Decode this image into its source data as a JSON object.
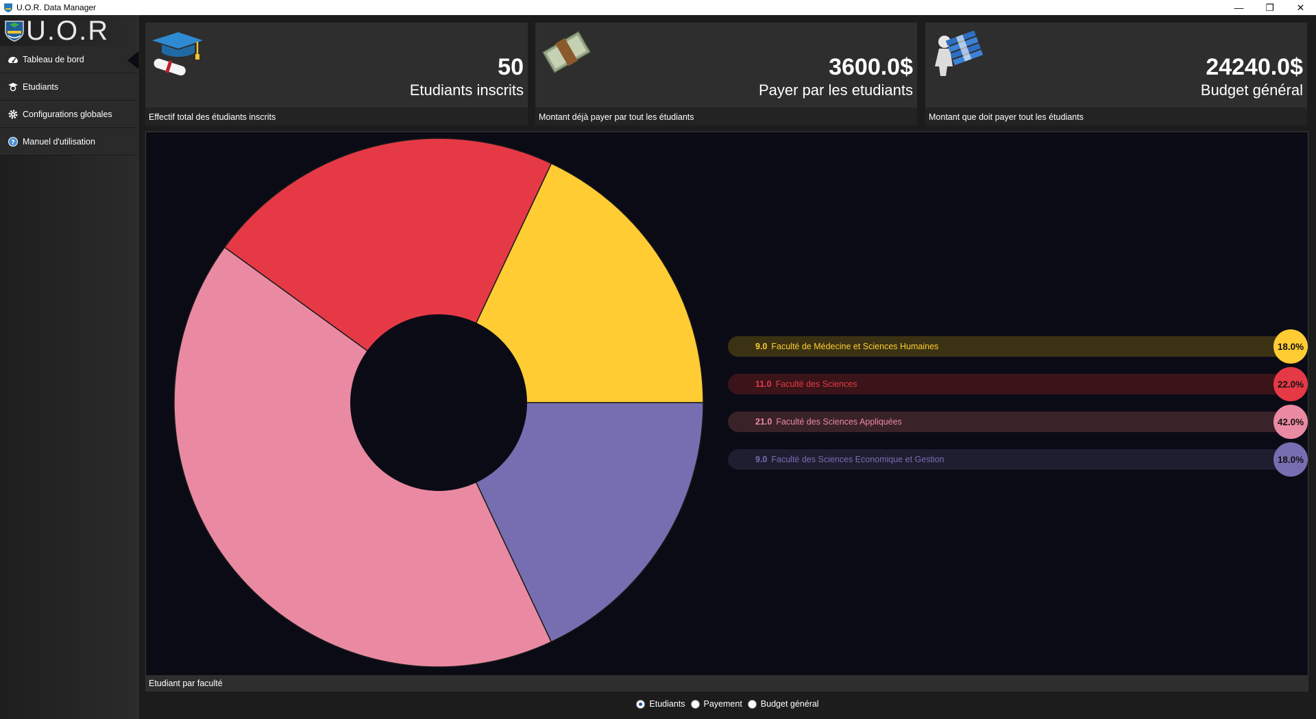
{
  "window": {
    "title": "U.O.R. Data Manager",
    "minimize": "—",
    "restore": "❐",
    "close": "✕"
  },
  "sidebar": {
    "logo_text": "U.O.R",
    "items": [
      {
        "label": "Tableau de bord",
        "icon": "dashboard-icon"
      },
      {
        "label": "Etudiants",
        "icon": "graduate-icon"
      },
      {
        "label": "Configurations globales",
        "icon": "gear-icon"
      },
      {
        "label": "Manuel d'utilisation",
        "icon": "help-icon"
      }
    ]
  },
  "cards": [
    {
      "value": "50",
      "subtitle": "Etudiants inscrits",
      "footer": "Effectif total des étudiants inscrits",
      "icon": "graduation-cap-icon"
    },
    {
      "value": "3600.0$",
      "subtitle": "Payer par les etudiants",
      "footer": "Montant déjà payer par tout les étudiants",
      "icon": "money-icon"
    },
    {
      "value": "24240.0$",
      "subtitle": "Budget général",
      "footer": "Montant que doit payer tout les étudiants",
      "icon": "folders-figure-icon"
    }
  ],
  "chart_footer": "Etudiant par faculté",
  "chart_data": {
    "type": "pie",
    "series": [
      {
        "name": "Faculté de Médecine et Sciences Humaines",
        "value": 9.0,
        "percent": "18.0%",
        "color": "#FFCC33",
        "bar": "#3a3212",
        "text": "#FFCC33"
      },
      {
        "name": "Faculté des Sciences",
        "value": 11.0,
        "percent": "22.0%",
        "color": "#E63946",
        "bar": "#3a1418",
        "text": "#E63946"
      },
      {
        "name": "Faculté des Sciences Appliquées",
        "value": 21.0,
        "percent": "42.0%",
        "color": "#EA8AA2",
        "bar": "#3a2229",
        "text": "#EA8AA2"
      },
      {
        "name": "Faculté des Sciences Economique et Gestion",
        "value": 9.0,
        "percent": "18.0%",
        "color": "#776EB2",
        "bar": "#1f1d30",
        "text": "#776EB2"
      }
    ],
    "start_angle_deg": 0,
    "hole": true
  },
  "radios": [
    {
      "label": "Etudiants",
      "checked": true
    },
    {
      "label": "Payement",
      "checked": false
    },
    {
      "label": "Budget général",
      "checked": false
    }
  ]
}
